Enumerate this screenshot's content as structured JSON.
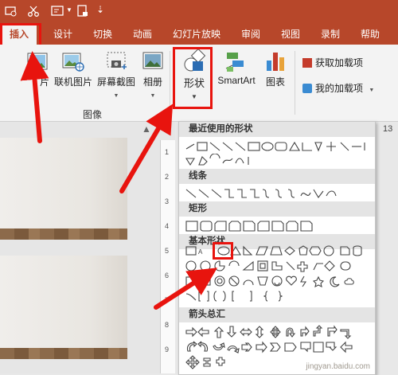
{
  "ribbon_tabs": [
    {
      "label": "插入",
      "active": true
    },
    {
      "label": "设计"
    },
    {
      "label": "切换"
    },
    {
      "label": "动画"
    },
    {
      "label": "幻灯片放映"
    },
    {
      "label": "审阅"
    },
    {
      "label": "视图"
    },
    {
      "label": "录制"
    },
    {
      "label": "帮助"
    }
  ],
  "ribbon": {
    "picture_label": "片",
    "online_picture_label": "联机图片",
    "screenshot_label": "屏幕截图",
    "album_label": "相册",
    "shapes_label": "形状",
    "smartart_label": "SmartArt",
    "chart_label": "图表",
    "images_group_label": "图像",
    "get_addins_label": "获取加载项",
    "my_addins_label": "我的加载项"
  },
  "shapes_menu": {
    "recent_label": "最近使用的形状",
    "lines_label": "线条",
    "rect_label": "矩形",
    "basic_label": "基本形状",
    "arrows_label": "箭头总汇"
  },
  "ruler_tick": "13",
  "ruler_numbers": [
    "1",
    "2",
    "3",
    "4",
    "5",
    "6",
    "7",
    "8",
    "9"
  ],
  "watermark": "jingyan.baidu.com",
  "colors": {
    "accent": "#b7472a",
    "highlight": "#e8140e",
    "arrow": "#e8140e"
  }
}
